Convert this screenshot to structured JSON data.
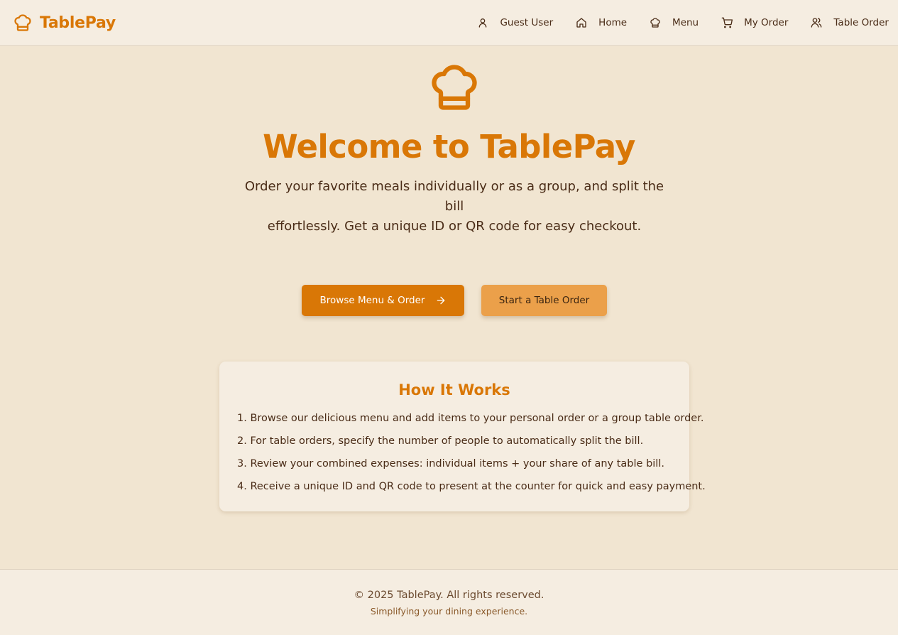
{
  "header": {
    "brand": "TablePay",
    "nav": [
      {
        "label": "Guest User",
        "icon": "user-icon"
      },
      {
        "label": "Home",
        "icon": "home-icon"
      },
      {
        "label": "Menu",
        "icon": "chef-hat-icon"
      },
      {
        "label": "My Order",
        "icon": "cart-icon"
      },
      {
        "label": "Table Order",
        "icon": "users-icon"
      }
    ]
  },
  "hero": {
    "title": "Welcome to TablePay",
    "subtitle_line1": "Order your favorite meals individually or as a group, and split the bill",
    "subtitle_line2": "effortlessly. Get a unique ID or QR code for easy checkout.",
    "primary_button": "Browse Menu & Order",
    "secondary_button": "Start a Table Order"
  },
  "how_it_works": {
    "title": "How It Works",
    "steps": [
      "1. Browse our delicious menu and add items to your personal order or a group table order.",
      "2. For table orders, specify the number of people to automatically split the bill.",
      "3. Review your combined expenses: individual items + your share of any table bill.",
      "4. Receive a unique ID and QR code to present at the counter for quick and easy payment."
    ]
  },
  "footer": {
    "copyright": "© 2025 TablePay. All rights reserved.",
    "tagline": "Simplifying your dining experience."
  },
  "colors": {
    "accent": "#d97706",
    "secondary_button": "#eba04a",
    "background": "#f1e5d1",
    "surface": "#f5ede1",
    "text": "#4a2c17"
  }
}
